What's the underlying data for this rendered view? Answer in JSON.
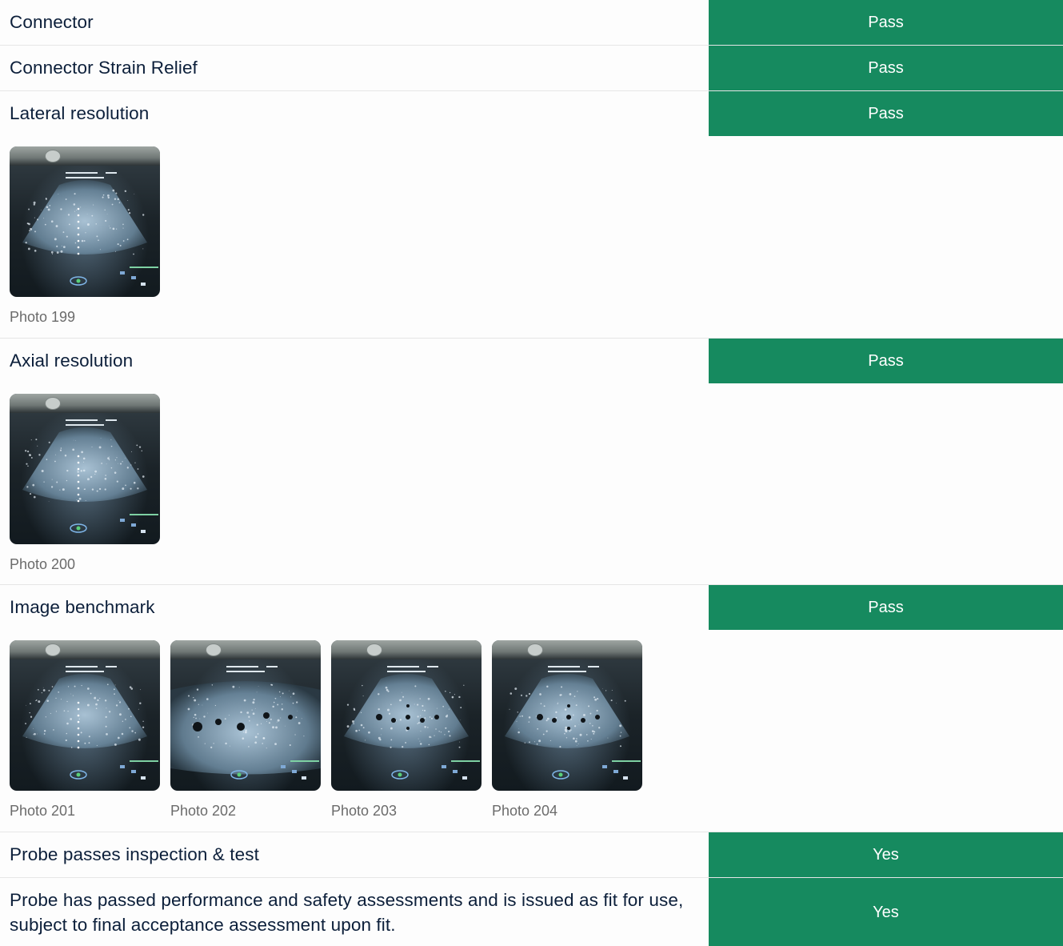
{
  "rows": [
    {
      "label": "Connector",
      "status": "Pass"
    },
    {
      "label": "Connector Strain Relief",
      "status": "Pass"
    },
    {
      "label": "Lateral resolution",
      "status": "Pass",
      "photos": [
        "Photo 199"
      ]
    },
    {
      "label": "Axial resolution",
      "status": "Pass",
      "photos": [
        "Photo 200"
      ]
    },
    {
      "label": "Image benchmark",
      "status": "Pass",
      "photos": [
        "Photo 201",
        "Photo 202",
        "Photo 203",
        "Photo 204"
      ]
    },
    {
      "label": "Probe passes inspection & test",
      "status": "Yes"
    },
    {
      "label": "Probe has passed performance and safety assessments and is issued as fit for use, subject to final acceptance assessment upon fit.",
      "status": "Yes"
    }
  ],
  "colors": {
    "status_background": "#168a5f",
    "label_text": "#0c1f3a",
    "caption_text": "#6b6b6b"
  },
  "icons": {
    "photo_thumbnail": "ultrasound-screen-photo"
  }
}
